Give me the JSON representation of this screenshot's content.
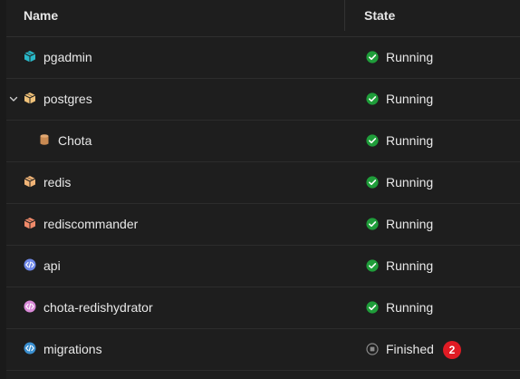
{
  "columns": {
    "name": "Name",
    "state": "State"
  },
  "colors": {
    "running": "#1f9d3a",
    "finished": "#8a8a8a",
    "badge": "#e01b24"
  },
  "rows": [
    {
      "name": "pgadmin",
      "icon": "container-icon",
      "icon_color": "#29b8c8",
      "state": "Running",
      "state_icon": "check-circle-icon"
    },
    {
      "name": "postgres",
      "icon": "container-icon",
      "icon_color": "#f0c27a",
      "state": "Running",
      "state_icon": "check-circle-icon",
      "expanded": true
    },
    {
      "name": "Chota",
      "icon": "database-icon",
      "icon_color": "#c98a52",
      "state": "Running",
      "state_icon": "check-circle-icon",
      "child": true
    },
    {
      "name": "redis",
      "icon": "container-icon",
      "icon_color": "#f0b477",
      "state": "Running",
      "state_icon": "check-circle-icon"
    },
    {
      "name": "rediscommander",
      "icon": "container-icon",
      "icon_color": "#f08a6a",
      "state": "Running",
      "state_icon": "check-circle-icon"
    },
    {
      "name": "api",
      "icon": "code-project-icon",
      "icon_color": "#6f88e8",
      "state": "Running",
      "state_icon": "check-circle-icon"
    },
    {
      "name": "chota-redishydrator",
      "icon": "code-project-icon",
      "icon_color": "#d98ad8",
      "state": "Running",
      "state_icon": "check-circle-icon"
    },
    {
      "name": "migrations",
      "icon": "code-project-icon",
      "icon_color": "#3a8fd0",
      "state": "Finished",
      "state_icon": "stop-circle-icon",
      "badge": "2"
    }
  ]
}
